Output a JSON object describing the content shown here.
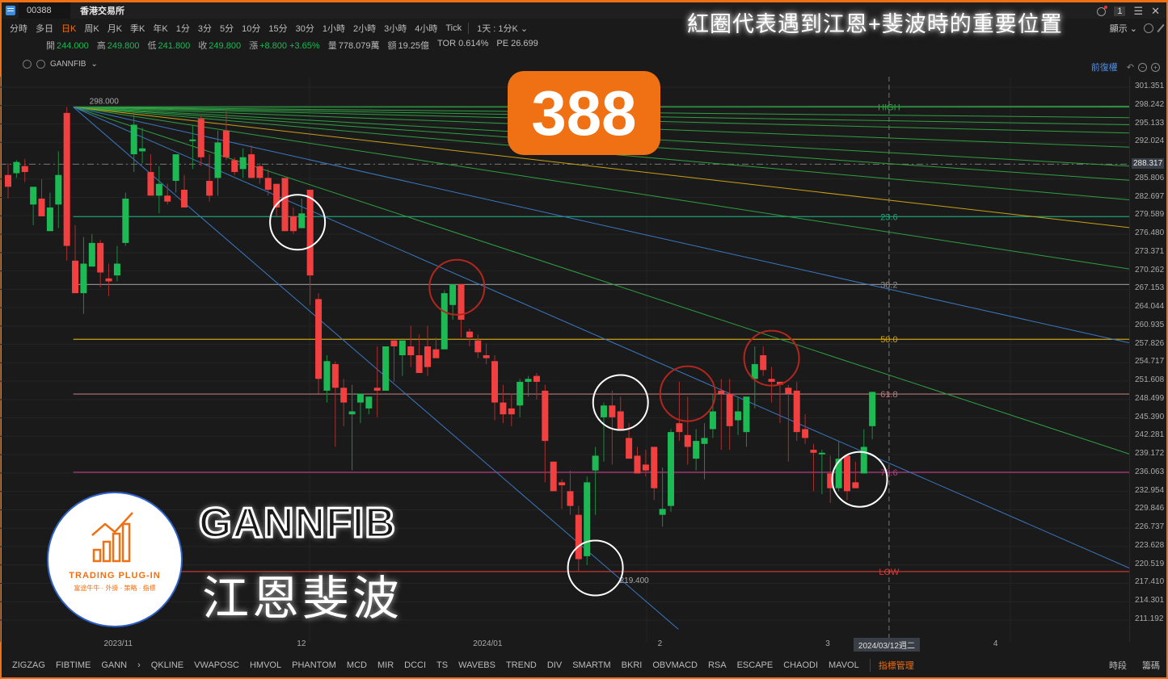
{
  "window": {
    "code": "00388",
    "exchange": "香港交易所",
    "page_num": "1",
    "headline": "紅圈代表遇到江恩+斐波時的重要位置"
  },
  "periods": {
    "items": [
      "分時",
      "多日",
      "日K",
      "周K",
      "月K",
      "季K",
      "年K",
      "1分",
      "3分",
      "5分",
      "10分",
      "15分",
      "30分",
      "1小時",
      "2小時",
      "3小時",
      "4小時",
      "Tick",
      "1天 : 1分K"
    ],
    "active": "日K",
    "display_label": "顯示"
  },
  "quote": {
    "open_label": "開",
    "open": "244.000",
    "high_label": "高",
    "high": "249.800",
    "low_label": "低",
    "low": "241.800",
    "close_label": "收",
    "close": "249.800",
    "change_label": "漲",
    "change": "+8.800",
    "change_pct": "+3.65%",
    "volume_label": "量",
    "volume": "778.079萬",
    "amount_label": "額",
    "amount": "19.25億",
    "tor": "TOR 0.614%",
    "pe": "PE 26.699"
  },
  "indicator": {
    "name": "GANNFIB",
    "adjust_label": "前復權"
  },
  "badge": "388",
  "logo": {
    "name": "TRADING PLUG-IN",
    "sub": "富途牛牛 · 外掛 · 策略 · 指標"
  },
  "overlay": {
    "title": "GANNFIB",
    "subtitle": "江恩斐波"
  },
  "bottom_bar": {
    "items": [
      "ZIGZAG",
      "FIBTIME",
      "GANN",
      "QKLINE",
      "VWAPOSC",
      "HMVOL",
      "PHANTOM",
      "MCD",
      "MIR",
      "DCCI",
      "TS",
      "WAVEBS",
      "TREND",
      "DIV",
      "SMARTM",
      "BKRI",
      "OBVMACD",
      "RSA",
      "ESCAPE",
      "CHAODI",
      "MAVOL"
    ],
    "manager": "指標管理",
    "right": [
      "時段",
      "籌碼"
    ]
  },
  "chart_data": {
    "type": "candlestick",
    "title": "00388 日K GANNFIB",
    "ylim": [
      211.192,
      301.351
    ],
    "y_ticks": [
      "301.351",
      "298.242",
      "295.133",
      "292.024",
      "288.317",
      "285.806",
      "282.697",
      "279.589",
      "276.480",
      "273.371",
      "270.262",
      "267.153",
      "264.044",
      "260.935",
      "257.826",
      "254.717",
      "251.608",
      "248.499",
      "245.390",
      "242.281",
      "239.172",
      "236.063",
      "232.954",
      "229.846",
      "226.737",
      "223.628",
      "220.519",
      "217.410",
      "214.301",
      "211.192"
    ],
    "current_price": "288.317",
    "x_ticks": [
      {
        "label": "2023/11",
        "index": 12
      },
      {
        "label": "12",
        "index": 35
      },
      {
        "label": "2024/01",
        "index": 56
      },
      {
        "label": "2",
        "index": 78
      },
      {
        "label": "3",
        "index": 98
      },
      {
        "label": "4",
        "index": 118
      }
    ],
    "crosshair_label": "2024/03/12週二",
    "crosshair_index": 105,
    "swing_high": {
      "label": "298.000",
      "value": 298.0,
      "index": 7
    },
    "swing_low": {
      "label": "219.400",
      "value": 219.4,
      "index": 70
    },
    "fib_levels": [
      {
        "label": "HIGH",
        "value": 298.0,
        "color": "#2ea043"
      },
      {
        "label": "23.6",
        "value": 279.45,
        "color": "#1aa87a"
      },
      {
        "label": "38.2",
        "value": 267.97,
        "color": "#8a8a8a"
      },
      {
        "label": "50.0",
        "value": 258.7,
        "color": "#c9a017"
      },
      {
        "label": "61.8",
        "value": 249.43,
        "color": "#b07a7a"
      },
      {
        "label": "78.6",
        "value": 236.2,
        "color": "#c03a8a"
      },
      {
        "label": "LOW",
        "value": 219.4,
        "color": "#d93a3a"
      }
    ],
    "gann_fan_end_values": [
      298.1,
      296.2,
      295.0,
      293.6,
      291.2,
      288.0,
      285.6,
      282.3,
      277.6,
      270.6,
      258.1,
      239.3,
      220.0
    ],
    "gann_fan_colors": [
      "#2ea043",
      "#2ea043",
      "#2ea043",
      "#2ea043",
      "#2ea043",
      "#2ea043",
      "#2ea043",
      "#2ea043",
      "#c9a017",
      "#2ea043",
      "#3a78c2",
      "#2ea043",
      "#3a78c2"
    ],
    "gann_steep_end": {
      "index": 77,
      "value": 211.0
    },
    "candles": [
      {
        "o": 286.5,
        "h": 288.5,
        "l": 282.5,
        "c": 284.5
      },
      {
        "o": 286.8,
        "h": 289.0,
        "l": 286.0,
        "c": 288.7
      },
      {
        "o": 288.0,
        "h": 289.2,
        "l": 285.3,
        "c": 287.0
      },
      {
        "o": 281.5,
        "h": 283.0,
        "l": 278.0,
        "c": 284.5
      },
      {
        "o": 282.5,
        "h": 285.8,
        "l": 280.0,
        "c": 279.5
      },
      {
        "o": 277.0,
        "h": 283.5,
        "l": 277.0,
        "c": 281.0
      },
      {
        "o": 281.5,
        "h": 290.5,
        "l": 277.5,
        "c": 286.5
      },
      {
        "o": 297.0,
        "h": 298.0,
        "l": 272.0,
        "c": 274.5
      },
      {
        "o": 272.0,
        "h": 278.0,
        "l": 269.0,
        "c": 266.5
      },
      {
        "o": 266.5,
        "h": 276.0,
        "l": 263.0,
        "c": 271.5
      },
      {
        "o": 271.0,
        "h": 276.5,
        "l": 271.0,
        "c": 275.0
      },
      {
        "o": 275.0,
        "h": 275.5,
        "l": 267.5,
        "c": 270.0
      },
      {
        "o": 269.0,
        "h": 271.5,
        "l": 266.0,
        "c": 268.5
      },
      {
        "o": 269.5,
        "h": 274.5,
        "l": 268.5,
        "c": 271.5
      },
      {
        "o": 275.0,
        "h": 283.5,
        "l": 274.5,
        "c": 282.5
      },
      {
        "o": 290.0,
        "h": 297.5,
        "l": 287.0,
        "c": 295.0
      },
      {
        "o": 290.5,
        "h": 294.5,
        "l": 288.5,
        "c": 291.0
      },
      {
        "o": 287.0,
        "h": 290.0,
        "l": 284.5,
        "c": 283.0
      },
      {
        "o": 283.0,
        "h": 288.0,
        "l": 280.0,
        "c": 285.0
      },
      {
        "o": 283.0,
        "h": 285.0,
        "l": 281.5,
        "c": 282.0
      },
      {
        "o": 285.5,
        "h": 288.5,
        "l": 283.5,
        "c": 290.0
      },
      {
        "o": 284.0,
        "h": 286.5,
        "l": 281.0,
        "c": 281.0
      },
      {
        "o": 292.5,
        "h": 295.0,
        "l": 287.5,
        "c": 292.5
      },
      {
        "o": 296.0,
        "h": 296.5,
        "l": 288.0,
        "c": 289.5
      },
      {
        "o": 285.5,
        "h": 290.0,
        "l": 282.0,
        "c": 283.0
      },
      {
        "o": 286.0,
        "h": 294.0,
        "l": 283.0,
        "c": 292.0
      },
      {
        "o": 294.0,
        "h": 297.5,
        "l": 289.0,
        "c": 289.5
      },
      {
        "o": 289.0,
        "h": 289.5,
        "l": 286.5,
        "c": 287.0
      },
      {
        "o": 287.5,
        "h": 291.0,
        "l": 286.0,
        "c": 289.5
      },
      {
        "o": 290.0,
        "h": 291.5,
        "l": 286.0,
        "c": 286.0
      },
      {
        "o": 288.0,
        "h": 288.5,
        "l": 285.0,
        "c": 286.0
      },
      {
        "o": 286.0,
        "h": 287.5,
        "l": 283.0,
        "c": 284.0
      },
      {
        "o": 285.0,
        "h": 285.0,
        "l": 279.5,
        "c": 281.0
      },
      {
        "o": 286.0,
        "h": 286.0,
        "l": 279.0,
        "c": 277.0
      },
      {
        "o": 279.5,
        "h": 281.0,
        "l": 276.5,
        "c": 277.0
      },
      {
        "o": 277.5,
        "h": 282.5,
        "l": 278.0,
        "c": 280.0
      },
      {
        "o": 284.0,
        "h": 284.0,
        "l": 264.5,
        "c": 269.5
      },
      {
        "o": 265.5,
        "h": 266.5,
        "l": 249.5,
        "c": 252.0
      },
      {
        "o": 250.0,
        "h": 256.0,
        "l": 248.0,
        "c": 255.0
      },
      {
        "o": 254.5,
        "h": 255.0,
        "l": 240.5,
        "c": 250.5
      },
      {
        "o": 250.5,
        "h": 252.0,
        "l": 244.0,
        "c": 248.0
      },
      {
        "o": 246.0,
        "h": 251.0,
        "l": 236.5,
        "c": 246.5
      },
      {
        "o": 248.0,
        "h": 249.5,
        "l": 244.5,
        "c": 249.5
      },
      {
        "o": 247.0,
        "h": 249.0,
        "l": 246.0,
        "c": 249.0
      },
      {
        "o": 250.5,
        "h": 257.5,
        "l": 245.5,
        "c": 250.0
      },
      {
        "o": 250.0,
        "h": 257.0,
        "l": 250.0,
        "c": 257.5
      },
      {
        "o": 258.5,
        "h": 258.5,
        "l": 251.5,
        "c": 257.5
      },
      {
        "o": 256.0,
        "h": 257.0,
        "l": 252.5,
        "c": 258.5
      },
      {
        "o": 257.5,
        "h": 261.0,
        "l": 254.0,
        "c": 256.0
      },
      {
        "o": 256.0,
        "h": 259.5,
        "l": 254.0,
        "c": 253.0
      },
      {
        "o": 257.5,
        "h": 261.0,
        "l": 252.5,
        "c": 254.0
      },
      {
        "o": 257.0,
        "h": 259.0,
        "l": 256.0,
        "c": 255.5
      },
      {
        "o": 257.0,
        "h": 267.0,
        "l": 257.0,
        "c": 266.5
      },
      {
        "o": 264.5,
        "h": 267.5,
        "l": 262.0,
        "c": 268.0
      },
      {
        "o": 268.0,
        "h": 268.0,
        "l": 259.0,
        "c": 262.0
      },
      {
        "o": 260.0,
        "h": 260.5,
        "l": 257.5,
        "c": 259.0
      },
      {
        "o": 258.5,
        "h": 259.5,
        "l": 255.5,
        "c": 256.5
      },
      {
        "o": 256.0,
        "h": 258.0,
        "l": 254.5,
        "c": 255.5
      },
      {
        "o": 255.0,
        "h": 256.0,
        "l": 245.0,
        "c": 248.0
      },
      {
        "o": 248.0,
        "h": 251.0,
        "l": 244.5,
        "c": 246.0
      },
      {
        "o": 247.0,
        "h": 249.5,
        "l": 244.0,
        "c": 246.0
      },
      {
        "o": 247.5,
        "h": 252.0,
        "l": 245.5,
        "c": 251.5
      },
      {
        "o": 251.5,
        "h": 252.5,
        "l": 249.0,
        "c": 252.0
      },
      {
        "o": 252.5,
        "h": 253.0,
        "l": 248.5,
        "c": 251.5
      },
      {
        "o": 250.0,
        "h": 251.0,
        "l": 234.5,
        "c": 241.5
      },
      {
        "o": 238.0,
        "h": 238.0,
        "l": 233.5,
        "c": 233.0
      },
      {
        "o": 234.5,
        "h": 235.0,
        "l": 230.0,
        "c": 234.0
      },
      {
        "o": 233.0,
        "h": 236.5,
        "l": 229.0,
        "c": 230.5
      },
      {
        "o": 229.0,
        "h": 230.5,
        "l": 219.4,
        "c": 221.5
      },
      {
        "o": 222.0,
        "h": 235.5,
        "l": 220.5,
        "c": 234.5
      },
      {
        "o": 236.5,
        "h": 240.5,
        "l": 229.0,
        "c": 239.0
      },
      {
        "o": 245.5,
        "h": 248.0,
        "l": 238.0,
        "c": 247.5
      },
      {
        "o": 247.5,
        "h": 250.0,
        "l": 237.5,
        "c": 245.5
      },
      {
        "o": 246.5,
        "h": 249.0,
        "l": 243.5,
        "c": 243.5
      },
      {
        "o": 242.0,
        "h": 244.5,
        "l": 238.5,
        "c": 238.5
      },
      {
        "o": 239.0,
        "h": 240.5,
        "l": 236.5,
        "c": 236.0
      },
      {
        "o": 237.5,
        "h": 240.0,
        "l": 235.5,
        "c": 236.5
      },
      {
        "o": 240.5,
        "h": 240.5,
        "l": 231.5,
        "c": 233.5
      },
      {
        "o": 229.0,
        "h": 237.0,
        "l": 227.0,
        "c": 230.0
      },
      {
        "o": 230.5,
        "h": 243.5,
        "l": 229.5,
        "c": 243.0
      },
      {
        "o": 244.5,
        "h": 251.5,
        "l": 241.5,
        "c": 243.0
      },
      {
        "o": 242.5,
        "h": 249.0,
        "l": 237.5,
        "c": 240.5
      },
      {
        "o": 238.5,
        "h": 243.5,
        "l": 236.5,
        "c": 241.5
      },
      {
        "o": 241.0,
        "h": 244.5,
        "l": 235.0,
        "c": 242.0
      },
      {
        "o": 243.5,
        "h": 249.5,
        "l": 242.0,
        "c": 246.5
      },
      {
        "o": 250.0,
        "h": 252.0,
        "l": 240.0,
        "c": 249.5
      },
      {
        "o": 249.5,
        "h": 252.0,
        "l": 240.0,
        "c": 244.0
      },
      {
        "o": 245.0,
        "h": 249.0,
        "l": 242.5,
        "c": 246.5
      },
      {
        "o": 243.0,
        "h": 248.5,
        "l": 240.5,
        "c": 249.0
      },
      {
        "o": 252.0,
        "h": 257.5,
        "l": 247.0,
        "c": 254.5
      },
      {
        "o": 256.0,
        "h": 257.5,
        "l": 252.5,
        "c": 253.5
      },
      {
        "o": 252.0,
        "h": 254.0,
        "l": 248.0,
        "c": 251.5
      },
      {
        "o": 251.5,
        "h": 251.5,
        "l": 244.5,
        "c": 251.0
      },
      {
        "o": 250.5,
        "h": 251.0,
        "l": 238.0,
        "c": 249.5
      },
      {
        "o": 250.0,
        "h": 251.5,
        "l": 241.5,
        "c": 243.0
      },
      {
        "o": 243.5,
        "h": 246.0,
        "l": 241.0,
        "c": 242.0
      },
      {
        "o": 240.0,
        "h": 241.0,
        "l": 233.0,
        "c": 239.5
      },
      {
        "o": 239.5,
        "h": 240.0,
        "l": 232.5,
        "c": 239.5
      },
      {
        "o": 236.0,
        "h": 239.0,
        "l": 231.0,
        "c": 233.5
      },
      {
        "o": 233.5,
        "h": 241.5,
        "l": 233.0,
        "c": 238.5
      },
      {
        "o": 239.0,
        "h": 239.0,
        "l": 231.5,
        "c": 233.0
      },
      {
        "o": 234.5,
        "h": 238.0,
        "l": 233.5,
        "c": 233.5
      },
      {
        "o": 236.0,
        "h": 243.5,
        "l": 236.0,
        "c": 240.5
      },
      {
        "o": 244.0,
        "h": 249.8,
        "l": 241.8,
        "c": 249.8
      }
    ],
    "circles": [
      {
        "index": 34.5,
        "value": 278.5,
        "color": "white"
      },
      {
        "index": 53.5,
        "value": 267.5,
        "color": "red"
      },
      {
        "index": 70,
        "value": 220.0,
        "color": "white"
      },
      {
        "index": 73,
        "value": 248.0,
        "color": "white"
      },
      {
        "index": 81,
        "value": 249.5,
        "color": "red"
      },
      {
        "index": 91,
        "value": 255.5,
        "color": "red"
      },
      {
        "index": 101.5,
        "value": 235.0,
        "color": "white"
      }
    ]
  }
}
